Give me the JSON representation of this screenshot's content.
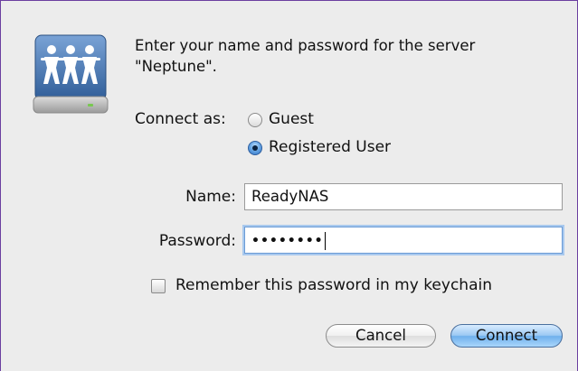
{
  "dialog": {
    "prompt": "Enter your name and password for the server \"Neptune\".",
    "connect_as_label": "Connect as:",
    "options": [
      {
        "label": "Guest",
        "selected": false
      },
      {
        "label": "Registered User",
        "selected": true
      }
    ],
    "name_label": "Name:",
    "name_value": "ReadyNAS",
    "password_label": "Password:",
    "password_masked": "••••••••",
    "remember_label": "Remember this password in my keychain",
    "remember_checked": false,
    "cancel_label": "Cancel",
    "connect_label": "Connect"
  },
  "icons": {
    "server": "network-server-icon"
  },
  "colors": {
    "focus_ring": "#a9c9ee",
    "default_button": "#6fb0ec",
    "icon_blue": "#3e6aa0"
  }
}
